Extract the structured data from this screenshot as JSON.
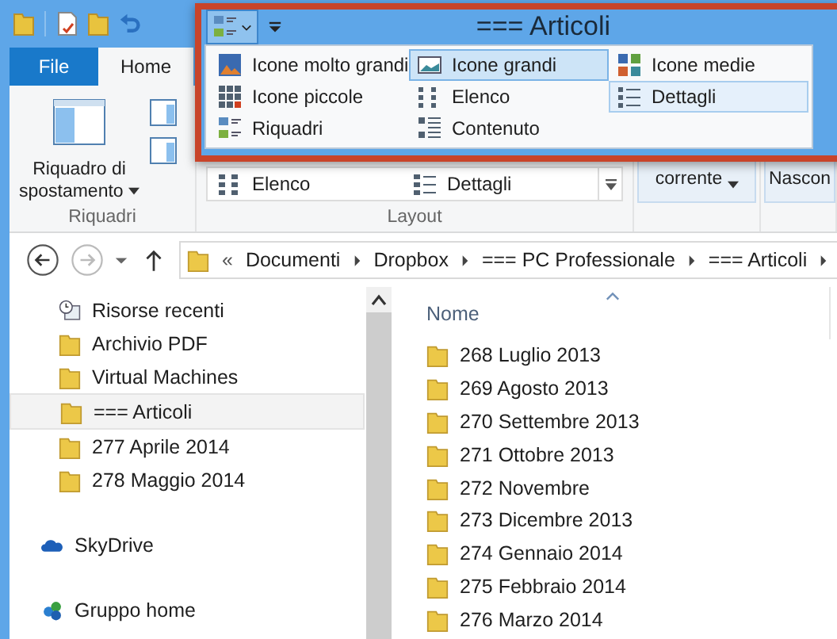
{
  "window": {
    "title": "=== Articoli"
  },
  "ribbon": {
    "tabs": [
      {
        "label": "File",
        "kind": "file",
        "selected": false
      },
      {
        "label": "Home",
        "kind": "tab",
        "selected": true
      }
    ],
    "panes_button": "Riquadro di spostamento",
    "panes_group": "Riquadri",
    "layout_items": [
      {
        "label": "Elenco",
        "kind": "list"
      },
      {
        "label": "Dettagli",
        "kind": "details"
      }
    ],
    "layout_group": "Layout",
    "current_view_label": "corrente",
    "cut_label": "Nascon"
  },
  "layout_menu": {
    "items": [
      {
        "label": "Icone molto grandi",
        "kind": "xl",
        "selected": false,
        "hovered": false
      },
      {
        "label": "Icone grandi",
        "kind": "large",
        "selected": true,
        "hovered": false
      },
      {
        "label": "Icone medie",
        "kind": "medium",
        "selected": false,
        "hovered": false
      },
      {
        "label": "Icone piccole",
        "kind": "small",
        "selected": false,
        "hovered": false
      },
      {
        "label": "Elenco",
        "kind": "list",
        "selected": false,
        "hovered": false
      },
      {
        "label": "Dettagli",
        "kind": "details",
        "selected": false,
        "hovered": true
      },
      {
        "label": "Riquadri",
        "kind": "tiles",
        "selected": false,
        "hovered": false
      },
      {
        "label": "Contenuto",
        "kind": "content",
        "selected": false,
        "hovered": false
      }
    ]
  },
  "address_bar": {
    "overflow": "«",
    "crumbs": [
      "Documenti",
      "Dropbox",
      "=== PC Professionale",
      "=== Articoli"
    ]
  },
  "navigation_pane": {
    "sections": [
      {
        "items": [
          {
            "label": "Risorse recenti",
            "kind": "recent",
            "selected": false
          },
          {
            "label": "Archivio PDF",
            "kind": "folder",
            "selected": false
          },
          {
            "label": "Virtual Machines",
            "kind": "folder",
            "selected": false
          },
          {
            "label": "=== Articoli",
            "kind": "folder",
            "selected": true
          },
          {
            "label": "277 Aprile 2014",
            "kind": "folder",
            "selected": false
          },
          {
            "label": "278 Maggio 2014",
            "kind": "folder",
            "selected": false
          }
        ]
      },
      {
        "items": [
          {
            "label": "SkyDrive",
            "kind": "cloud",
            "selected": false
          }
        ]
      },
      {
        "items": [
          {
            "label": "Gruppo home",
            "kind": "homegroup",
            "selected": false
          }
        ]
      }
    ]
  },
  "file_list": {
    "column": "Nome",
    "rows": [
      "268 Luglio 2013",
      "269 Agosto 2013",
      "270 Settembre 2013",
      "271 Ottobre 2013",
      "272 Novembre",
      "273 Dicembre 2013",
      "274 Gennaio 2014",
      "275 Febbraio 2014",
      "276 Marzo 2014"
    ]
  }
}
